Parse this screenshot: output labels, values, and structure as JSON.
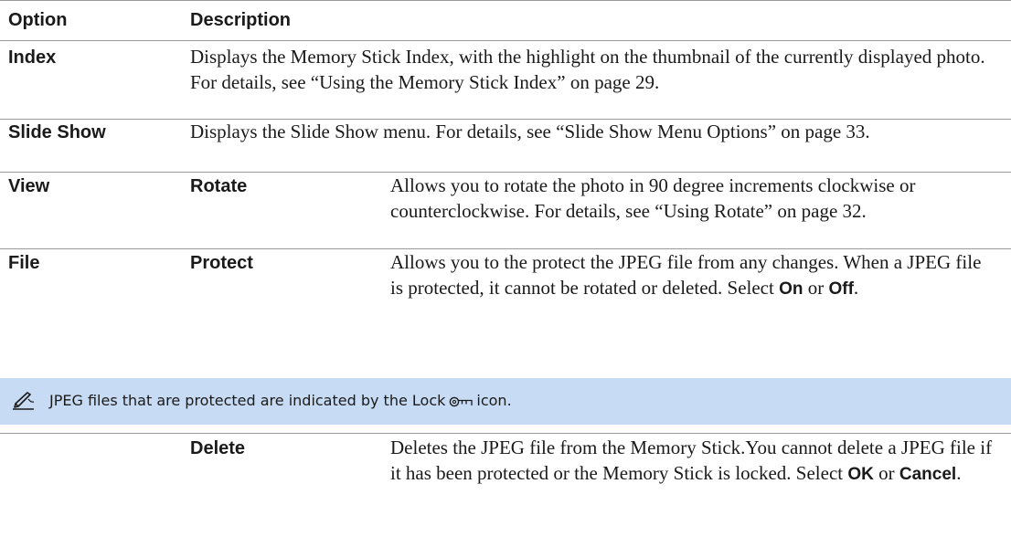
{
  "table": {
    "header": {
      "option": "Option",
      "description": "Description"
    },
    "rows": [
      {
        "option": "Index",
        "description": "Displays the Memory Stick Index, with the highlight on the thumbnail of the currently displayed photo. For details, see “Using the Memory Stick Index” on page 29."
      },
      {
        "option": "Slide Show",
        "description": "Displays the Slide Show menu. For details, see “Slide Show Menu Options” on page 33."
      },
      {
        "option": "View",
        "suboption": "Rotate",
        "description": "Allows you to rotate the photo in 90 degree increments clockwise or counterclockwise. For details, see “Using Rotate” on page 32."
      },
      {
        "option": "File",
        "suboption": "Protect",
        "description_pre": "Allows you to the protect the JPEG file from any changes. When a JPEG file is protected, it cannot be rotated or deleted. Select ",
        "choice_1": "On",
        "description_mid": " or ",
        "choice_2": "Off",
        "description_post": "."
      }
    ],
    "note": {
      "icon": "note-pencil-icon",
      "text_pre": "JPEG files that are protected are indicated by the Lock",
      "lock_icon": "lock-key-icon",
      "text_post": "icon."
    },
    "delete_row": {
      "option": "",
      "suboption": "Delete",
      "description_pre": "Deletes the JPEG file from the Memory Stick.You cannot delete a JPEG file if it has been protected or the Memory Stick is locked. Select ",
      "choice_1": "OK",
      "description_mid": " or ",
      "choice_2": "Cancel",
      "description_post": "."
    }
  }
}
